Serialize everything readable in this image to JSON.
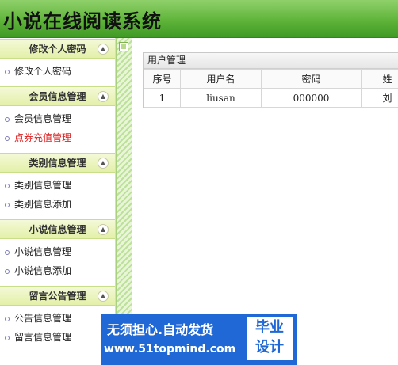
{
  "header": {
    "title": "小说在线阅读系统"
  },
  "sidebar": {
    "groups": [
      {
        "title": "修改个人密码",
        "items": [
          {
            "label": "修改个人密码"
          }
        ]
      },
      {
        "title": "会员信息管理",
        "items": [
          {
            "label": "会员信息管理"
          },
          {
            "label": "点券充值管理"
          }
        ]
      },
      {
        "title": "类别信息管理",
        "items": [
          {
            "label": "类别信息管理"
          },
          {
            "label": "类别信息添加"
          }
        ]
      },
      {
        "title": "小说信息管理",
        "items": [
          {
            "label": "小说信息管理"
          },
          {
            "label": "小说信息添加"
          }
        ]
      },
      {
        "title": "留言公告管理",
        "items": [
          {
            "label": "公告信息管理"
          },
          {
            "label": "留言信息管理"
          }
        ]
      }
    ]
  },
  "main": {
    "panel_title": "用户管理",
    "columns": [
      "序号",
      "用户名",
      "密码",
      "姓"
    ],
    "rows": [
      [
        "1",
        "liusan",
        "000000",
        "刘"
      ]
    ]
  },
  "ad": {
    "line1": "无须担心.自动发货",
    "line2": "www.51topmind.com",
    "badge_line1": "毕业",
    "badge_line2": "设计"
  },
  "colors": {
    "header_green": "#5fb43a",
    "active_link": "#dd2222",
    "ad_blue": "#1f68d6"
  }
}
